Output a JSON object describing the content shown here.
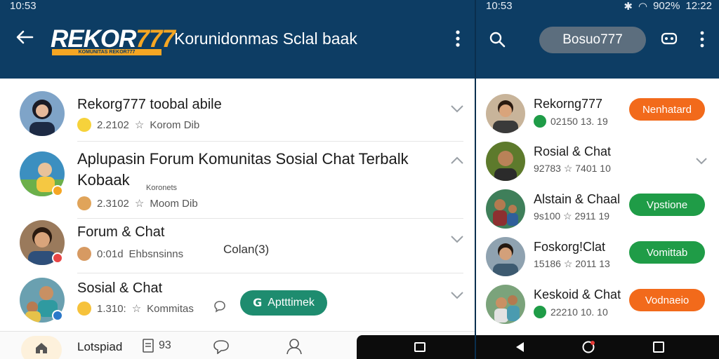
{
  "colors": {
    "appbar": "#0d3d64",
    "brand_accent": "#f5a623",
    "green_button": "#1e8c6f",
    "orange_button": "#f26a1b",
    "green_status_button": "#1f9c47"
  },
  "left": {
    "status_time": "10:53",
    "brand": {
      "main": "REKOR",
      "num": "777",
      "sub": "KOMUNITAS REKOR777"
    },
    "title": "Korunidonmas Sclal baak",
    "items": [
      {
        "title": "Rekorg777 toobal abile",
        "meta_count": "2.2102",
        "meta_text": "Korom Dib"
      },
      {
        "title": "Aplupasin Forum Komunitas Sosial Chat Terbalk Kobaak",
        "sub": "Koronets",
        "meta_count": "2.3102",
        "meta_text": "Moom Dib"
      },
      {
        "title": "Forum & Chat",
        "meta_count": "0:01d",
        "meta_text": "Ehbsnsinns",
        "note": "Colan(3)"
      },
      {
        "title": "Sosial & Chat",
        "meta_count": "1.310:",
        "meta_text": "Kommitas",
        "action": "Aptttimek"
      }
    ],
    "bottom_nav": {
      "label": "Lotspiad",
      "doc_text": "93"
    }
  },
  "right": {
    "status_time": "10:53",
    "status_battery": "902%",
    "status_clock": "12:22",
    "chip_label": "Bosuo777",
    "items": [
      {
        "title": "Rekorng777",
        "meta": "02150 13. 19",
        "button": "Nenhatard",
        "button_style": "orange"
      },
      {
        "title": "Rosial & Chat",
        "meta": "92783 ☆ 7401 10",
        "button": "",
        "button_style": ""
      },
      {
        "title": "Alstain & Chaal",
        "meta": "9s100 ☆ 2911 19",
        "button": "Vpstione",
        "button_style": "green"
      },
      {
        "title": "Foskorg!Clat",
        "meta": "15186 ☆ 2011 13",
        "button": "Vomittab",
        "button_style": "green"
      },
      {
        "title": "Keskoid & Chat",
        "meta": "22210 10. 10",
        "button": "Vodnaeio",
        "button_style": "orange"
      }
    ]
  }
}
